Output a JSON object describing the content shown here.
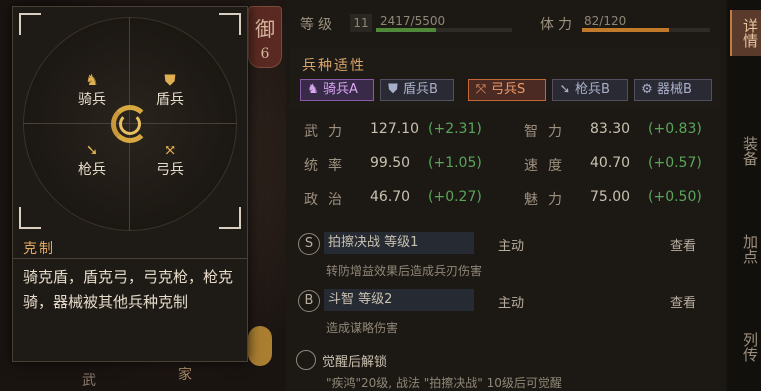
{
  "seal": {
    "char": "御",
    "num": "6"
  },
  "bottom_left": {
    "a": "武",
    "b": "家"
  },
  "header": {
    "level_label": "等级",
    "level": "11",
    "exp_text": "2417/5500",
    "exp_fraction": 0.44,
    "stamina_label": "体力",
    "stamina_text": "82/120",
    "stamina_fraction": 0.68
  },
  "affinity": {
    "title": "兵种适性",
    "tags": [
      {
        "icon": "horse-icon",
        "glyph": "♞",
        "label": "骑兵A"
      },
      {
        "icon": "shield-icon",
        "glyph": "⛊",
        "label": "盾兵B"
      },
      {
        "icon": "bow-icon",
        "glyph": "⤧",
        "label": "弓兵S"
      },
      {
        "icon": "spear-icon",
        "glyph": "➘",
        "label": "枪兵B"
      },
      {
        "icon": "machine-icon",
        "glyph": "⚙",
        "label": "器械B"
      }
    ]
  },
  "stats": [
    {
      "key": "武力",
      "value": "127.10",
      "delta": "(+2.31)"
    },
    {
      "key": "智力",
      "value": "83.30",
      "delta": "(+0.83)"
    },
    {
      "key": "统率",
      "value": "99.50",
      "delta": "(+1.05)"
    },
    {
      "key": "速度",
      "value": "40.70",
      "delta": "(+0.57)"
    },
    {
      "key": "政治",
      "value": "46.70",
      "delta": "(+0.27)"
    },
    {
      "key": "魅力",
      "value": "75.00",
      "delta": "(+0.50)"
    }
  ],
  "skills": [
    {
      "badge": "S",
      "name": "拍擦决战 等级1",
      "type": "主动",
      "view": "查看",
      "desc": "转防增益效果后造成兵刃伤害"
    },
    {
      "badge": "B",
      "name": "斗智 等级2",
      "type": "主动",
      "view": "查看",
      "desc": "造成谋略伤害"
    }
  ],
  "awaken": {
    "title": "觉醒后解锁",
    "desc": "\"疾鸿\"20级, 战法 \"拍擦决战\" 10级后可觉醒"
  },
  "side_tabs": [
    "详情",
    "装备",
    "加点",
    "列传"
  ],
  "tooltip": {
    "units": {
      "cavalry": "骑兵",
      "shield": "盾兵",
      "spear": "枪兵",
      "bow": "弓兵"
    },
    "heading": "克制",
    "body": "骑克盾，盾克弓，弓克枪，枪克骑，器械被其他兵种克制"
  }
}
